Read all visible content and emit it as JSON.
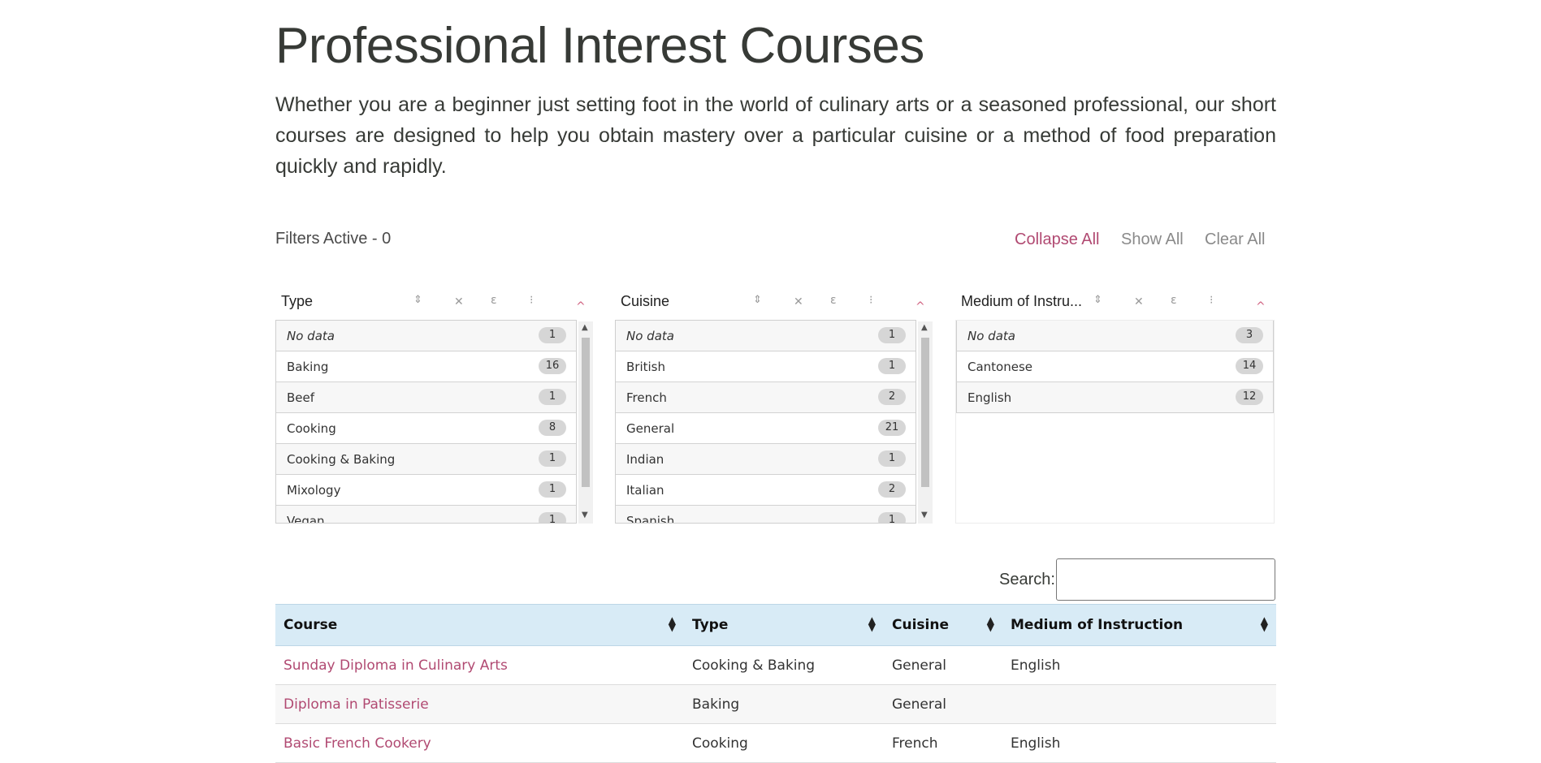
{
  "page": {
    "title": "Professional Interest Courses",
    "intro": "Whether you are a beginner just setting foot in the world of culinary arts or a seasoned professional, our short courses are designed to help you obtain mastery over a particular cuisine or a method of food preparation quickly and rapidly."
  },
  "filters": {
    "active_label": "Filters Active - 0",
    "collapse_all": "Collapse All",
    "show_all": "Show All",
    "clear_all": "Clear All"
  },
  "panes": [
    {
      "title": "Type",
      "items": [
        {
          "label": "No data",
          "count": "1"
        },
        {
          "label": "Baking",
          "count": "16"
        },
        {
          "label": "Beef",
          "count": "1"
        },
        {
          "label": "Cooking",
          "count": "8"
        },
        {
          "label": "Cooking & Baking",
          "count": "1"
        },
        {
          "label": "Mixology",
          "count": "1"
        },
        {
          "label": "Vegan",
          "count": "1"
        }
      ]
    },
    {
      "title": "Cuisine",
      "items": [
        {
          "label": "No data",
          "count": "1"
        },
        {
          "label": "British",
          "count": "1"
        },
        {
          "label": "French",
          "count": "2"
        },
        {
          "label": "General",
          "count": "21"
        },
        {
          "label": "Indian",
          "count": "1"
        },
        {
          "label": "Italian",
          "count": "2"
        },
        {
          "label": "Spanish",
          "count": "1"
        }
      ]
    },
    {
      "title": "Medium of Instru...",
      "items": [
        {
          "label": "No data",
          "count": "3"
        },
        {
          "label": "Cantonese",
          "count": "14"
        },
        {
          "label": "English",
          "count": "12"
        }
      ]
    }
  ],
  "search": {
    "label": "Search:",
    "value": ""
  },
  "table": {
    "headers": [
      "Course",
      "Type",
      "Cuisine",
      "Medium of Instruction"
    ],
    "rows": [
      [
        "Sunday Diploma in Culinary Arts",
        "Cooking & Baking",
        "General",
        "English"
      ],
      [
        "Diploma in Patisserie",
        "Baking",
        "General",
        ""
      ],
      [
        "Basic French Cookery",
        "Cooking",
        "French",
        "English"
      ]
    ]
  },
  "icons": {
    "sort": "sort-icon",
    "clear": "clear-icon",
    "case": "case-icon",
    "more": "more-icon",
    "collapse": "caret-up-icon"
  },
  "colors": {
    "accent": "#b14a72",
    "header_bg": "#d8ebf6",
    "text": "#373a36"
  }
}
